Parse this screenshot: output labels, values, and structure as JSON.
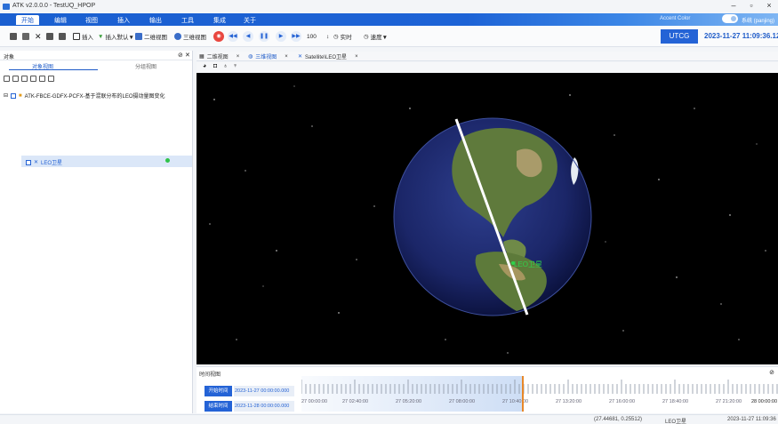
{
  "window": {
    "title": "ATK v2.0.0.0 - TestUQ_HPOP",
    "buttons": [
      "–",
      "▫",
      "×"
    ]
  },
  "menu": {
    "items": [
      "开始",
      "编辑",
      "视图",
      "插入",
      "输出",
      "工具",
      "集成",
      "关于"
    ],
    "active_index": 0,
    "right_label": "系统 (panjing)",
    "right_secondary": "Accent Color"
  },
  "toolbar": {
    "insert_label": "插入",
    "insert_default_label": "插入默认▼",
    "view2d_label": "二维视图",
    "view3d_label": "三维视图",
    "step_value": "100",
    "realtime_label": "实时",
    "speed_label": "速度▼"
  },
  "clock": {
    "utcg_label": "UTCG",
    "value": "2023-11-27 11:09:36.128"
  },
  "left_panel": {
    "title": "对象",
    "tabs": [
      "对象视图",
      "分组视图"
    ],
    "active_tab": 0,
    "scenario_label": "ATK-FBCE-GDFX-PCFX-基于混联分布的LEO摄动量图变化",
    "satellite_label": "LEO卫星",
    "colors": {
      "status_dot": "#2fc24a",
      "accent": "#1e5bc8"
    }
  },
  "view_tabs": [
    {
      "label": "二维视图",
      "icon": "map-icon"
    },
    {
      "label": "三维视图",
      "icon": "globe-icon"
    },
    {
      "label": "Satellite\\LEO卫星",
      "icon": "satellite-icon"
    }
  ],
  "viewport": {
    "satellite_label": "LEO卫星",
    "colors": {
      "background": "#000000",
      "orbit": "#ffffff",
      "label": "#2fd24c"
    }
  },
  "timeline": {
    "title": "时间视图",
    "start_label": "开始时间",
    "start_value": "2023-11-27 00:00:00.000",
    "end_label": "结束时间",
    "end_value": "2023-11-28 00:00:00.000",
    "ticks": [
      "27 00:00:00",
      "27 02:40:00",
      "27 05:20:00",
      "27 08:00:00",
      "27 10:40:00",
      "27 13:20:00",
      "27 16:00:00",
      "27 18:40:00",
      "27 21:20:00",
      "28 00:00:00"
    ],
    "current_fraction": 0.465
  },
  "status": {
    "coords": "(27.44681, 0.25512)",
    "object": "LEO卫星",
    "time": "2023-11-27 11:09:36"
  }
}
